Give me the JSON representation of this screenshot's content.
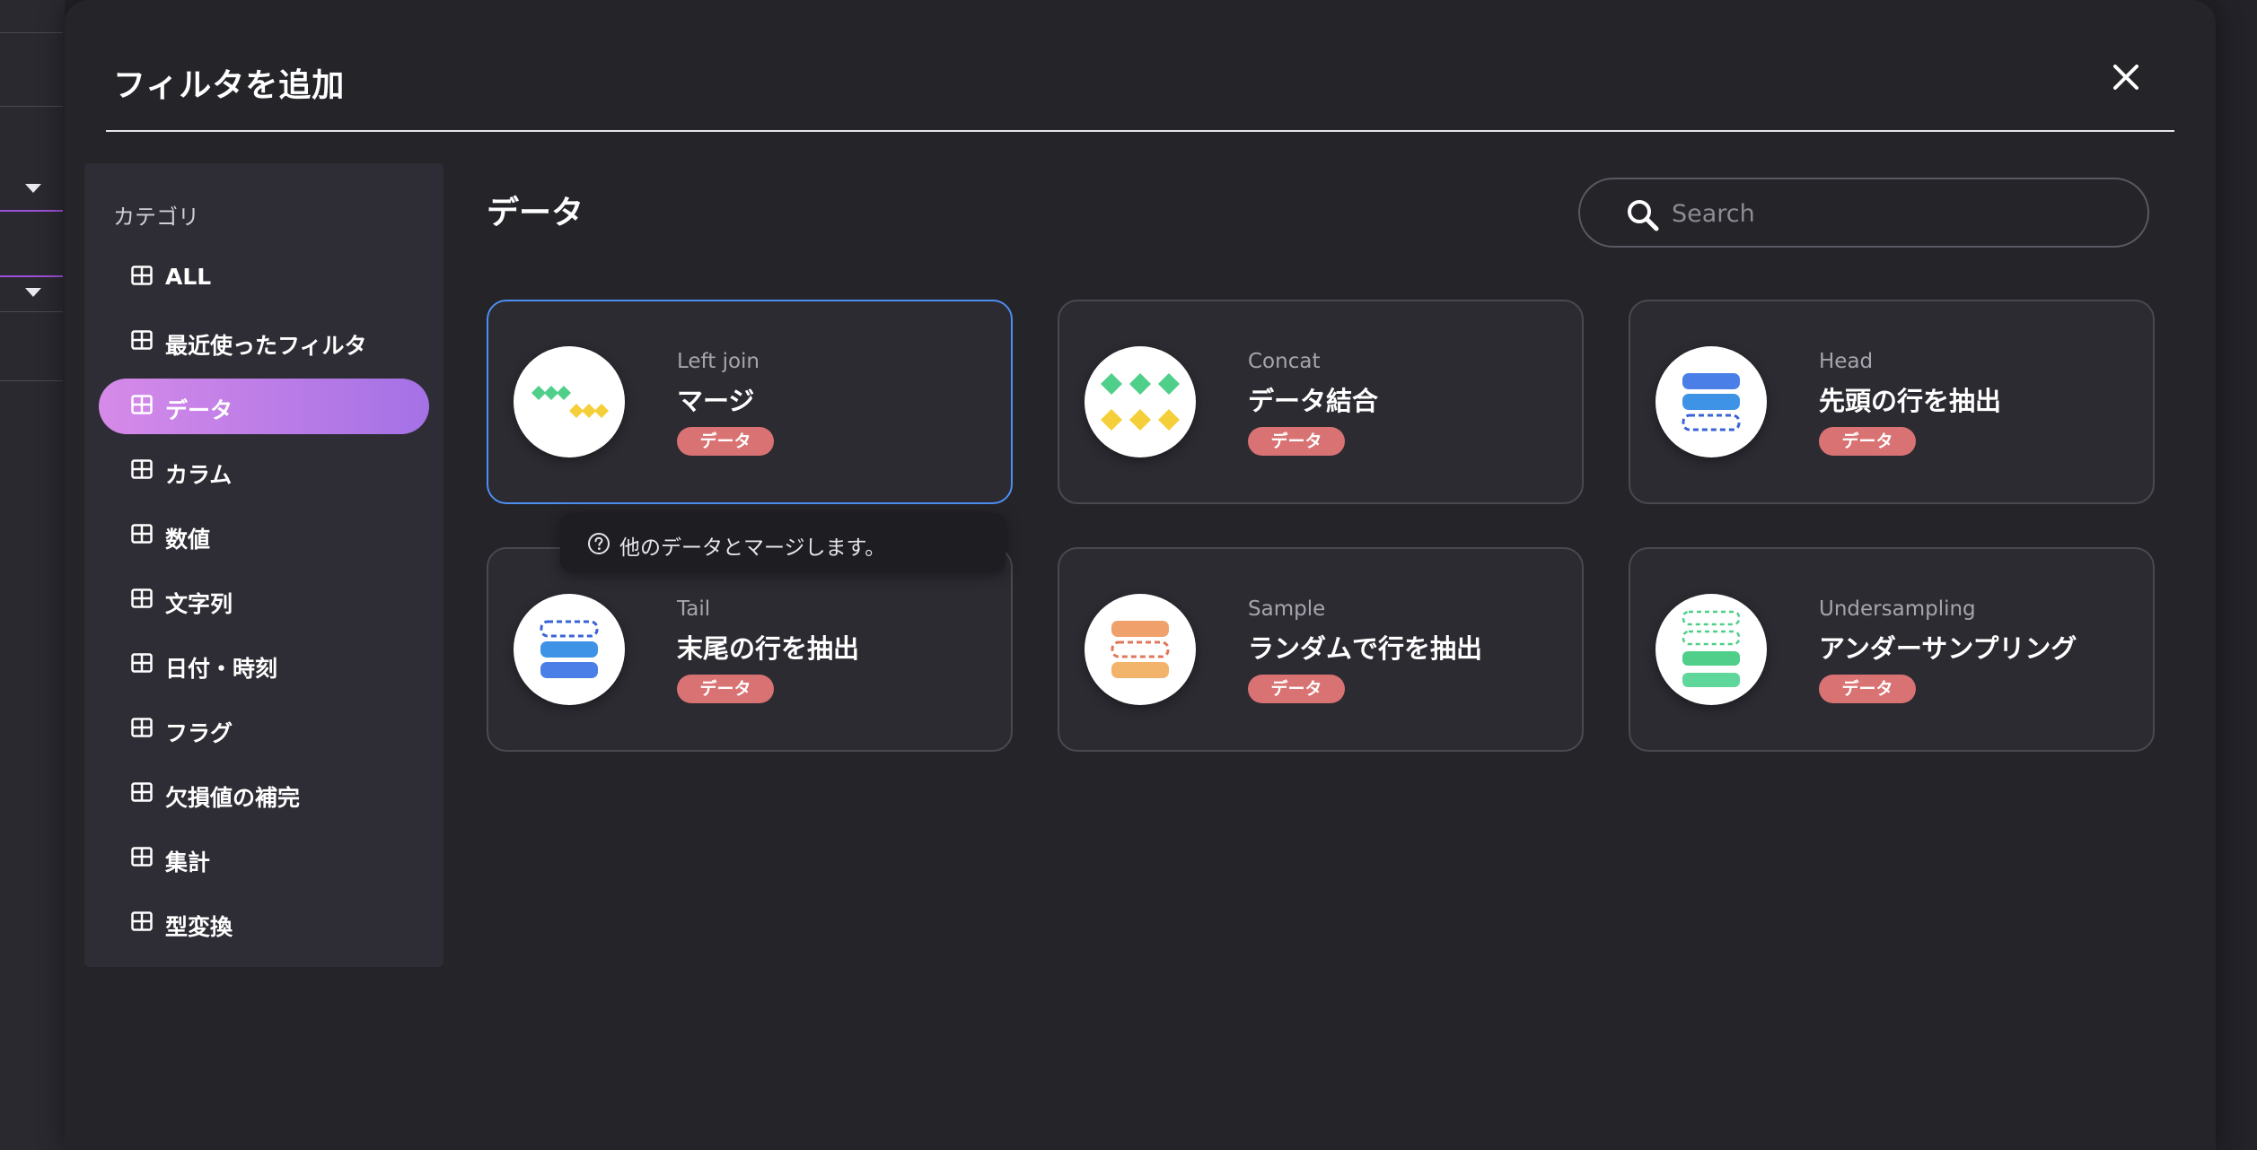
{
  "modal": {
    "title": "フィルタを追加",
    "close_icon": "close-icon"
  },
  "sidebar": {
    "heading": "カテゴリ",
    "active_color": "#c07ce7",
    "items": [
      {
        "label": "ALL",
        "icon": "table-icon"
      },
      {
        "label": "最近使ったフィルタ",
        "icon": "table-icon"
      },
      {
        "label": "データ",
        "icon": "table-icon",
        "active": true
      },
      {
        "label": "カラム",
        "icon": "table-icon"
      },
      {
        "label": "数値",
        "icon": "table-icon"
      },
      {
        "label": "文字列",
        "icon": "table-icon"
      },
      {
        "label": "日付・時刻",
        "icon": "table-icon"
      },
      {
        "label": "フラグ",
        "icon": "table-icon"
      },
      {
        "label": "欠損値の補完",
        "icon": "table-icon"
      },
      {
        "label": "集計",
        "icon": "table-icon"
      },
      {
        "label": "型変換",
        "icon": "table-icon"
      }
    ]
  },
  "main": {
    "section_title": "データ",
    "search": {
      "placeholder": "Search",
      "value": ""
    },
    "cards": [
      {
        "en": "Left join",
        "ja": "マージ",
        "badge": "データ",
        "icon": "merge-icon",
        "selected": true
      },
      {
        "en": "Concat",
        "ja": "データ結合",
        "badge": "データ",
        "icon": "concat-icon"
      },
      {
        "en": "Head",
        "ja": "先頭の行を抽出",
        "badge": "データ",
        "icon": "head-rows-icon"
      },
      {
        "en": "Tail",
        "ja": "末尾の行を抽出",
        "badge": "データ",
        "icon": "tail-rows-icon"
      },
      {
        "en": "Sample",
        "ja": "ランダムで行を抽出",
        "badge": "データ",
        "icon": "sample-rows-icon"
      },
      {
        "en": "Undersampling",
        "ja": "アンダーサンプリング",
        "badge": "データ",
        "icon": "undersampling-icon"
      }
    ],
    "tooltip": {
      "text": "他のデータとマージします。",
      "icon": "help-icon"
    }
  },
  "colors": {
    "badge": "#d97272",
    "selected_border": "#4d8ef0",
    "card_bg": "#2c2b32"
  }
}
